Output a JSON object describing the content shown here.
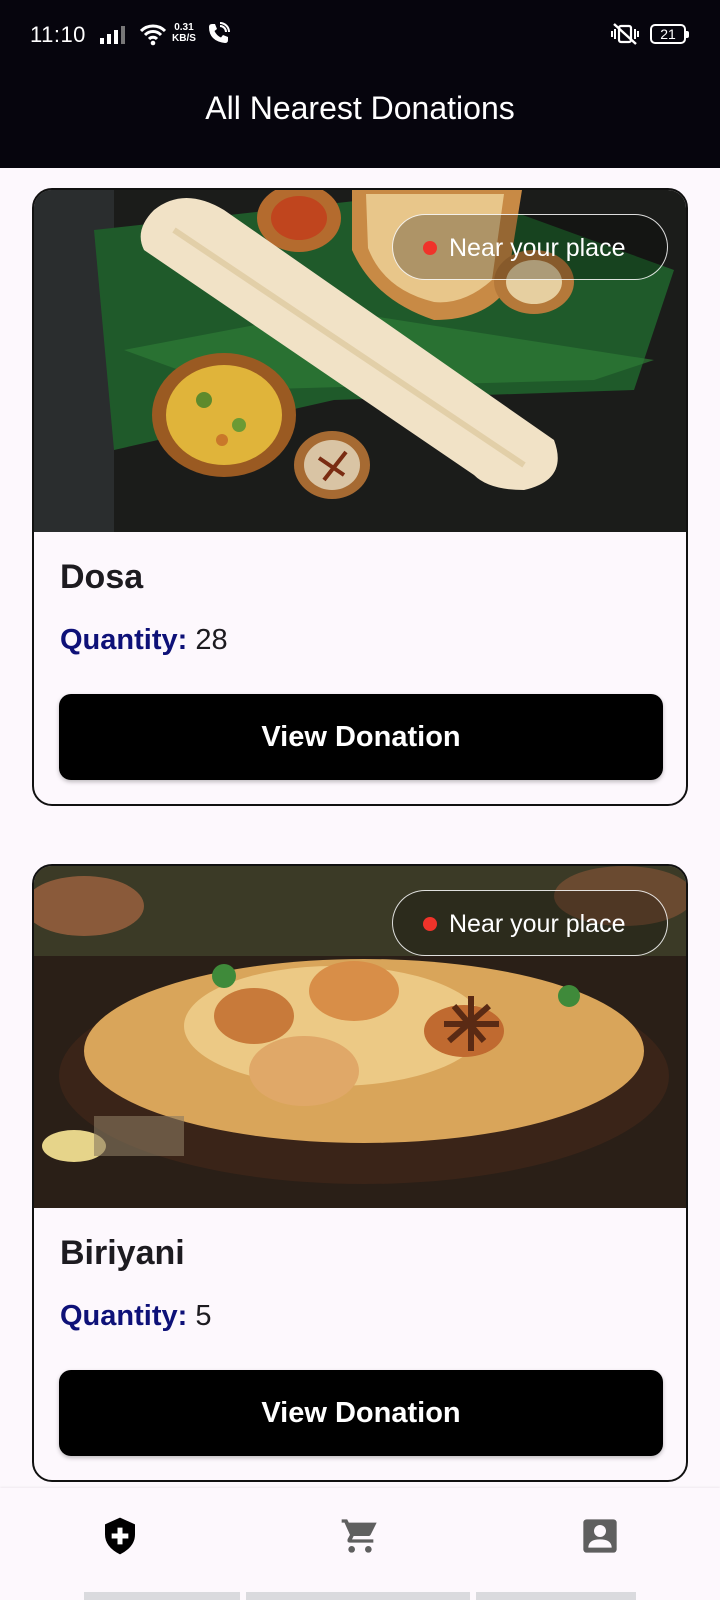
{
  "status_bar": {
    "time": "11:10",
    "net_speed_value": "0.31",
    "net_speed_unit": "KB/S",
    "battery": "21",
    "icons": [
      "signal-icon",
      "wifi-icon",
      "call-icon",
      "vibrate-mute-icon",
      "battery-icon"
    ]
  },
  "app_bar": {
    "title": "All Nearest Donations"
  },
  "donations": [
    {
      "name": "Dosa",
      "quantity_label": "Quantity:",
      "quantity": "28",
      "badge": "Near your place",
      "button_label": "View Donation"
    },
    {
      "name": "Biriyani",
      "quantity_label": "Quantity:",
      "quantity": "5",
      "badge": "Near your place",
      "button_label": "View Donation"
    }
  ],
  "bottom_nav": {
    "items": [
      {
        "icon": "shield-plus-icon",
        "active": true
      },
      {
        "icon": "cart-icon",
        "active": false
      },
      {
        "icon": "profile-icon",
        "active": false
      }
    ]
  },
  "colors": {
    "header_bg": "#06050d",
    "page_bg": "#fdf8fd",
    "quantity_label": "#0e1178",
    "badge_dot": "#f0332a",
    "button_bg": "#000000"
  }
}
